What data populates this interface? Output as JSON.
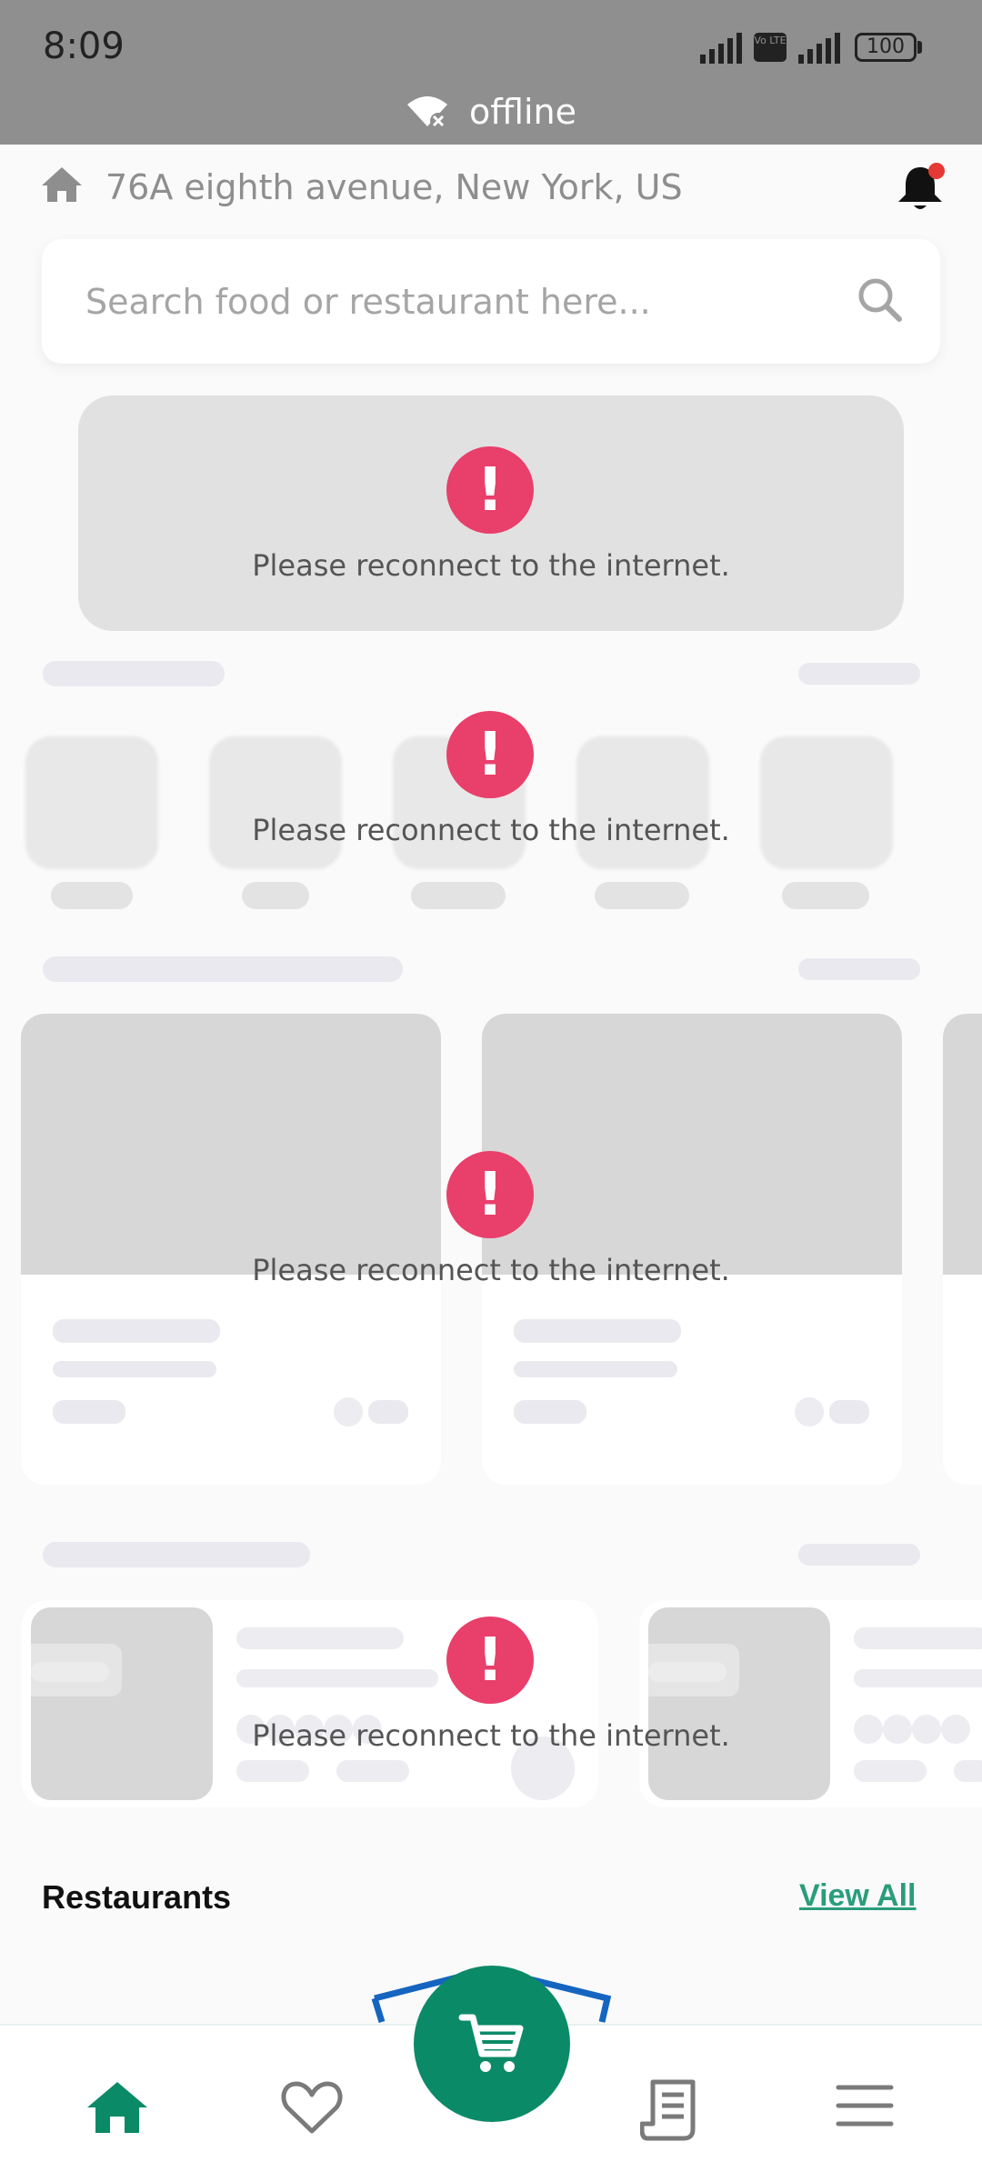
{
  "status_bar": {
    "time": "8:09",
    "volte_label": "Vo LTE",
    "battery": "100",
    "network_state": "offline"
  },
  "header": {
    "address": "76A eighth avenue, New York, US",
    "has_notification": true
  },
  "search": {
    "placeholder": "Search food or restaurant here..."
  },
  "error": {
    "message": "Please reconnect to the internet.",
    "icon": "!"
  },
  "restaurants_section": {
    "title": "Restaurants",
    "view_all": "View All"
  },
  "bottom_nav": {
    "items": [
      "home-icon",
      "heart-icon",
      "cart-icon",
      "receipt-icon",
      "menu-icon"
    ],
    "active": "home-icon"
  },
  "colors": {
    "accent": "#0b8a67",
    "error": "#e93f6b",
    "link": "#2a9d7a",
    "notification_dot": "#e53935"
  }
}
